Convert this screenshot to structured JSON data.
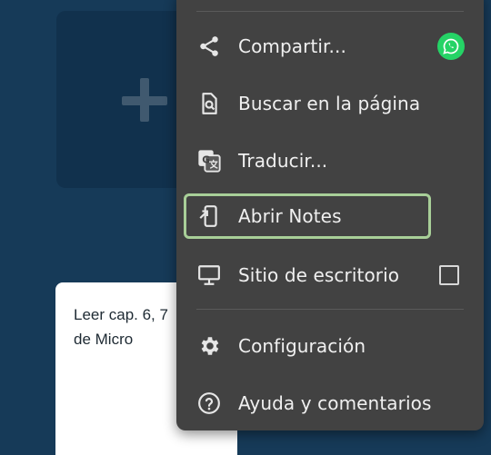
{
  "menu": {
    "items": [
      {
        "label": "Compartir...",
        "icon": "share-icon",
        "trailing": "whatsapp-icon"
      },
      {
        "label": "Buscar en la página",
        "icon": "find-in-page-icon"
      },
      {
        "label": "Traducir...",
        "icon": "translate-icon"
      },
      {
        "label": "Abrir Notes",
        "icon": "open-in-app-icon",
        "highlighted": true
      },
      {
        "label": "Sitio de escritorio",
        "icon": "desktop-icon",
        "checkbox": false
      },
      {
        "label": "Configuración",
        "icon": "gear-icon"
      },
      {
        "label": "Ayuda y comentarios",
        "icon": "help-icon"
      }
    ]
  },
  "background": {
    "note_text": "Leer cap. 6, 7\nde Micro",
    "add_tile_icon": "plus-icon"
  },
  "colors": {
    "page_background": "#163a58",
    "menu_background": "#424242",
    "highlight_border": "#a8cf98",
    "whatsapp": "#25d366"
  }
}
